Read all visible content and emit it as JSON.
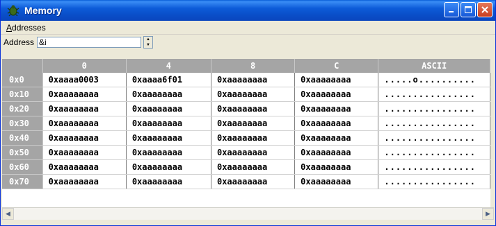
{
  "window": {
    "title": "Memory"
  },
  "menu": {
    "items": [
      {
        "label": "Addresses",
        "mnemonic": "A",
        "rest": "ddresses"
      }
    ]
  },
  "address": {
    "label": "Address",
    "value": "&i"
  },
  "grid": {
    "headers": [
      "",
      "0",
      "4",
      "8",
      "C",
      "ASCII"
    ],
    "rows": [
      {
        "addr": "0x0",
        "c0": "0xaaaa0003",
        "c4": "0xaaaa6f01",
        "c8": "0xaaaaaaaa",
        "cc": "0xaaaaaaaa",
        "ascii": ".....o.........."
      },
      {
        "addr": "0x10",
        "c0": "0xaaaaaaaa",
        "c4": "0xaaaaaaaa",
        "c8": "0xaaaaaaaa",
        "cc": "0xaaaaaaaa",
        "ascii": "................"
      },
      {
        "addr": "0x20",
        "c0": "0xaaaaaaaa",
        "c4": "0xaaaaaaaa",
        "c8": "0xaaaaaaaa",
        "cc": "0xaaaaaaaa",
        "ascii": "................"
      },
      {
        "addr": "0x30",
        "c0": "0xaaaaaaaa",
        "c4": "0xaaaaaaaa",
        "c8": "0xaaaaaaaa",
        "cc": "0xaaaaaaaa",
        "ascii": "................"
      },
      {
        "addr": "0x40",
        "c0": "0xaaaaaaaa",
        "c4": "0xaaaaaaaa",
        "c8": "0xaaaaaaaa",
        "cc": "0xaaaaaaaa",
        "ascii": "................"
      },
      {
        "addr": "0x50",
        "c0": "0xaaaaaaaa",
        "c4": "0xaaaaaaaa",
        "c8": "0xaaaaaaaa",
        "cc": "0xaaaaaaaa",
        "ascii": "................"
      },
      {
        "addr": "0x60",
        "c0": "0xaaaaaaaa",
        "c4": "0xaaaaaaaa",
        "c8": "0xaaaaaaaa",
        "cc": "0xaaaaaaaa",
        "ascii": "................"
      },
      {
        "addr": "0x70",
        "c0": "0xaaaaaaaa",
        "c4": "0xaaaaaaaa",
        "c8": "0xaaaaaaaa",
        "cc": "0xaaaaaaaa",
        "ascii": "................"
      }
    ]
  },
  "colors": {
    "titlebar": "#0a4fc9",
    "header": "#a5a5a5",
    "window_bg": "#ece9d8"
  },
  "icons": {
    "window": "bug-icon",
    "minimize": "minimize-icon",
    "maximize": "maximize-icon",
    "close": "close-icon",
    "scroll_left": "scroll-left-icon",
    "scroll_right": "scroll-right-icon"
  }
}
